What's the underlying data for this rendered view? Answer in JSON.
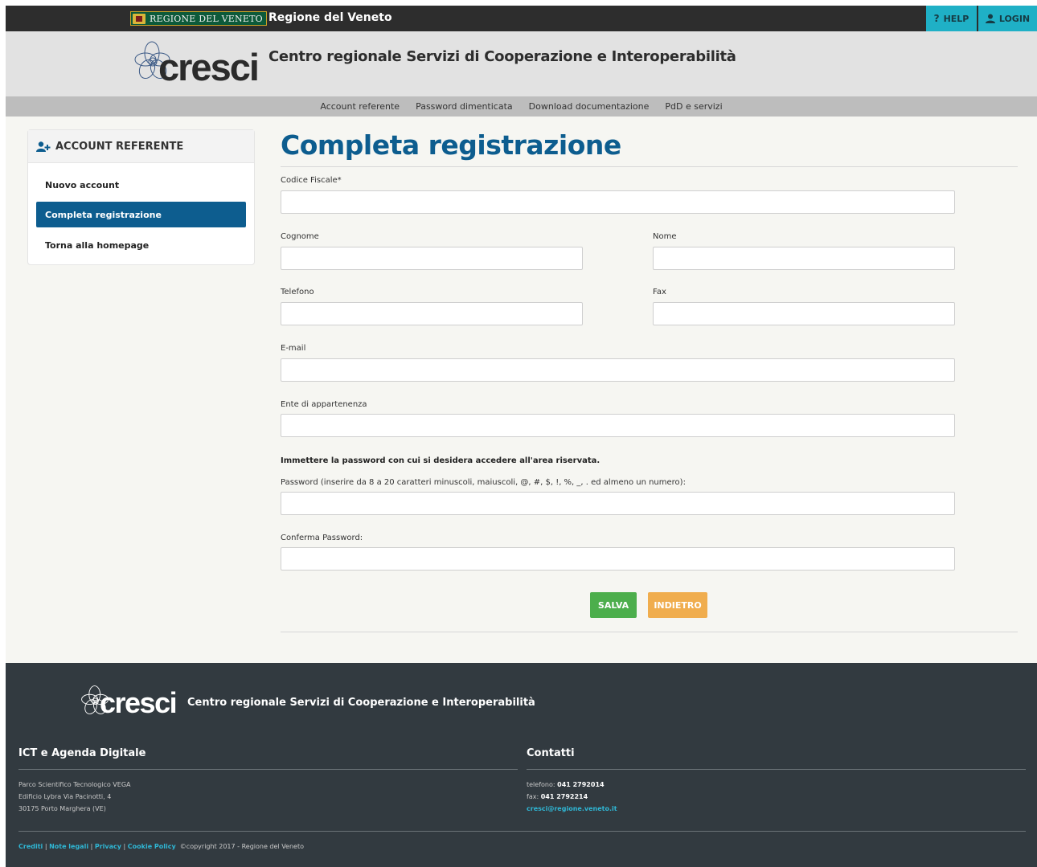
{
  "topbar": {
    "logo_text": "REGIONE DEL VENETO",
    "title": "Regione del Veneto",
    "help_label": "HELP",
    "login_label": "LOGIN"
  },
  "header": {
    "logo_word": "cresci",
    "title": "Centro regionale Servizi di Cooperazione e Interoperabilità"
  },
  "nav": {
    "items": [
      "Account referente",
      "Password dimenticata",
      "Download documentazione",
      "PdD e servizi"
    ]
  },
  "sidebar": {
    "title": "ACCOUNT REFERENTE",
    "items": [
      {
        "label": "Nuovo account"
      },
      {
        "label": "Completa registrazione"
      },
      {
        "label": "Torna alla homepage"
      }
    ]
  },
  "form": {
    "title": "Completa registrazione",
    "codice_fiscale_label": "Codice Fiscale*",
    "cognome_label": "Cognome",
    "nome_label": "Nome",
    "telefono_label": "Telefono",
    "fax_label": "Fax",
    "email_label": "E-mail",
    "ente_label": "Ente di appartenenza",
    "password_note": "Immettere la password con cui si desidera accedere all'area riservata.",
    "password_label": "Password (inserire da 8 a 20 caratteri minuscoli, maiuscoli, @, #, $, !, %, _, . ed almeno un numero):",
    "conferma_label": "Conferma Password:",
    "save_label": "SALVA",
    "back_label": "INDIETRO"
  },
  "footer": {
    "logo_word": "cresci",
    "title": "Centro regionale Servizi di Cooperazione e Interoperabilità",
    "ict_heading": "ICT e Agenda Digitale",
    "address": [
      "Parco Scientifico Tecnologico VEGA",
      "Edificio Lybra Via Pacinotti, 4",
      "30175 Porto Marghera (VE)"
    ],
    "contatti_heading": "Contatti",
    "phone_label": "telefono:",
    "phone": "041 2792014",
    "fax_label": "fax:",
    "fax": "041 2792214",
    "email": "cresci@regione.veneto.it",
    "links": [
      "Crediti",
      "Note legali",
      "Privacy",
      "Cookie Policy"
    ],
    "copyright": "©copyright 2017 - Regione del Veneto"
  },
  "colors": {
    "primary": "#0d5d8f",
    "accent": "#1fb0c6",
    "save": "#4cae4c",
    "back": "#f0ad4e",
    "footer_bg": "#323a40"
  }
}
